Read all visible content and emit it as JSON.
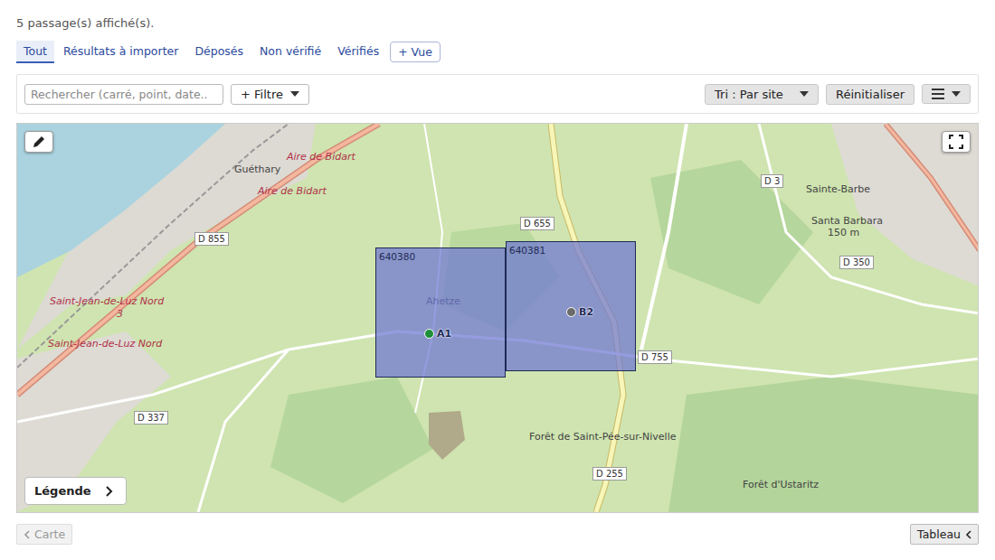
{
  "status": "5 passage(s) affiché(s).",
  "tabs": [
    {
      "label": "Tout",
      "selected": true
    },
    {
      "label": "Résultats à importer",
      "selected": false
    },
    {
      "label": "Déposés",
      "selected": false
    },
    {
      "label": "Non vérifié",
      "selected": false
    },
    {
      "label": "Vérifiés",
      "selected": false
    }
  ],
  "add_view": "+ Vue",
  "toolbar": {
    "search_placeholder": "Rechercher (carré, point, date..",
    "filter": "+ Filtre",
    "sort": "Tri : Par site",
    "reset": "Réinitialiser"
  },
  "map": {
    "squares": [
      {
        "label": "640380"
      },
      {
        "label": "640381"
      }
    ],
    "points": [
      {
        "label": "A1",
        "color": "#1f8f3a"
      },
      {
        "label": "B2",
        "color": "#6b6b6b"
      }
    ],
    "labels": [
      {
        "text": "Guéthary",
        "kind": "place"
      },
      {
        "text": "Aire de Bidart",
        "kind": "poi"
      },
      {
        "text": "Aire de Bidart",
        "kind": "poi"
      },
      {
        "text": "D 855",
        "kind": "road"
      },
      {
        "text": "Saint-Jean-de-Luz Nord",
        "kind": "poi"
      },
      {
        "text": "3",
        "kind": "poi"
      },
      {
        "text": "Saint-Jean-de-Luz Nord",
        "kind": "poi"
      },
      {
        "text": "D 655",
        "kind": "road"
      },
      {
        "text": "D 3",
        "kind": "road"
      },
      {
        "text": "Sainte-Barbe",
        "kind": "place"
      },
      {
        "text": "Santa Barbara",
        "kind": "place"
      },
      {
        "text": "150 m",
        "kind": "place"
      },
      {
        "text": "D 350",
        "kind": "road"
      },
      {
        "text": "Ahetze",
        "kind": "place"
      },
      {
        "text": "D 755",
        "kind": "road"
      },
      {
        "text": "D 337",
        "kind": "road"
      },
      {
        "text": "Forêt de Saint-Pée-sur-Nivelle",
        "kind": "place"
      },
      {
        "text": "D 255",
        "kind": "road"
      },
      {
        "text": "Forêt d'Ustaritz",
        "kind": "place"
      }
    ],
    "legend": "Légende"
  },
  "footer": {
    "left": {
      "label": "Carte",
      "disabled": true
    },
    "right": {
      "label": "Tableau",
      "disabled": false
    }
  }
}
